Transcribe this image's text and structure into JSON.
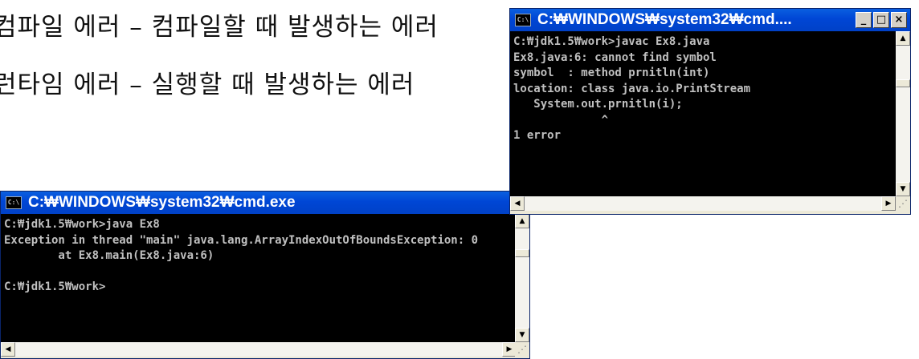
{
  "slide": {
    "line1": "컴파일 에러 – 컴파일할 때 발생하는 에러",
    "line2": "런타임 에러 – 실행할 때 발생하는 에러"
  },
  "windows": {
    "compile": {
      "title": "C:₩WINDOWS₩system32₩cmd....",
      "icon_label": "C:\\",
      "lines": [
        "C:₩jdk1.5₩work>javac Ex8.java",
        "Ex8.java:6: cannot find symbol",
        "symbol  : method prnitln(int)",
        "location: class java.io.PrintStream",
        "   System.out.prnitln(i);",
        "             ^",
        "1 error",
        ""
      ]
    },
    "runtime": {
      "title": "C:₩WINDOWS₩system32₩cmd.exe",
      "icon_label": "C:\\",
      "lines": [
        "C:₩jdk1.5₩work>java Ex8",
        "Exception in thread \"main\" java.lang.ArrayIndexOutOfBoundsException: 0",
        "        at Ex8.main(Ex8.java:6)",
        "",
        "C:₩jdk1.5₩work>",
        ""
      ]
    }
  },
  "controls": {
    "minimize": "_",
    "maximize": "□",
    "close": "×",
    "scroll_up": "▲",
    "scroll_down": "▼",
    "scroll_left": "◀",
    "scroll_right": "▶",
    "grip": "⋰"
  },
  "colors": {
    "titlebar": "#0046d5",
    "console_bg": "#000000",
    "console_fg": "#c0c0c0"
  }
}
